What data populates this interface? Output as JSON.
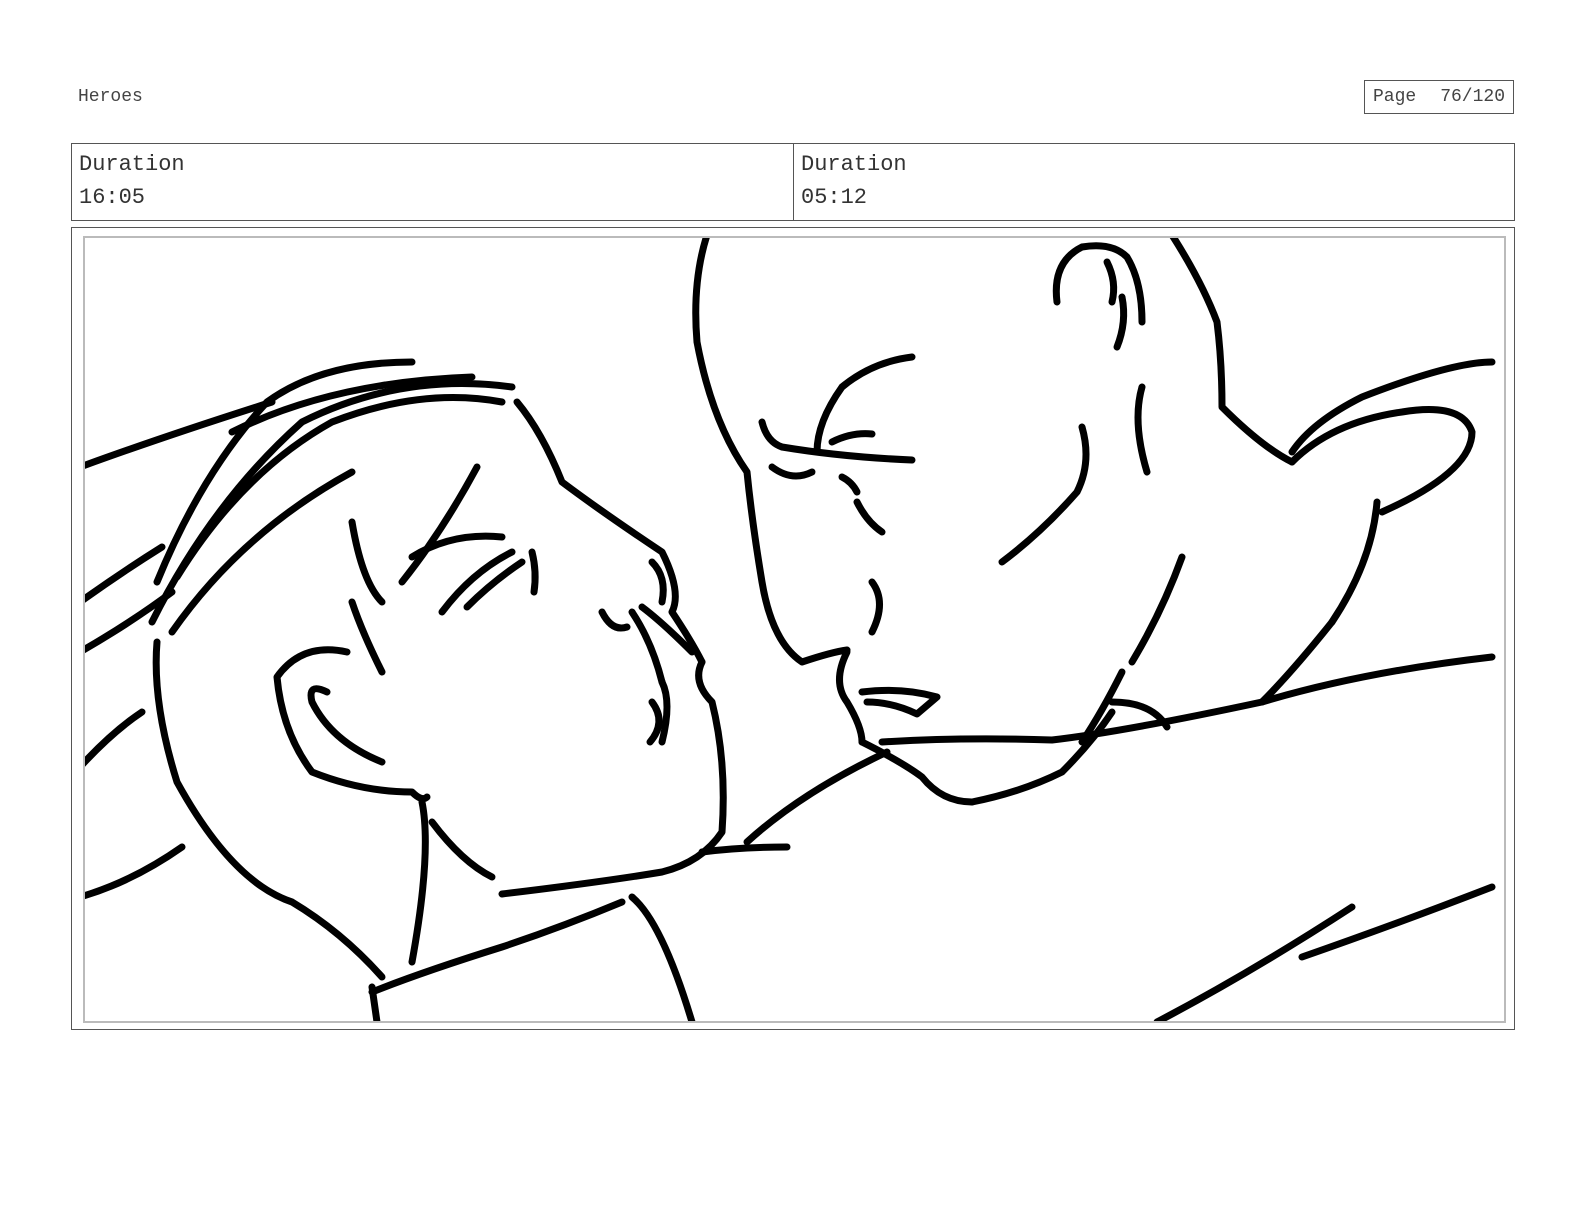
{
  "header": {
    "project_title": "Heroes",
    "page_label": "Page",
    "page_number": "76/120"
  },
  "shots": [
    {
      "duration_label": "Duration",
      "duration_value": "16:05"
    },
    {
      "duration_label": "Duration",
      "duration_value": "05:12"
    }
  ]
}
